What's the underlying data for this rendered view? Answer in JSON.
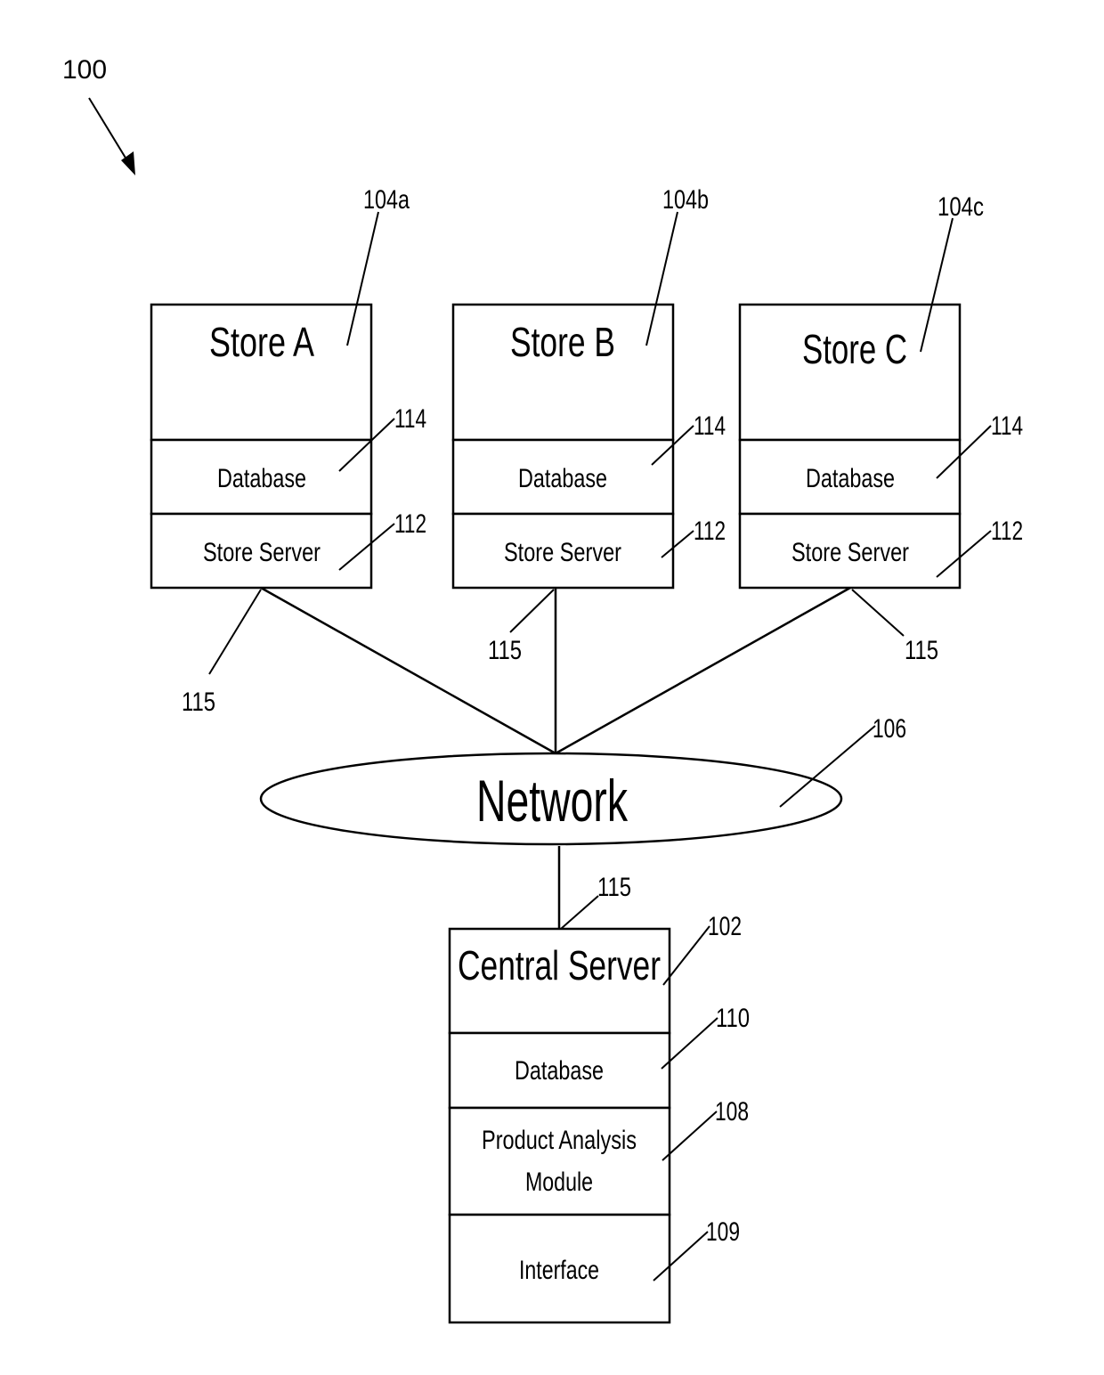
{
  "figure": {
    "ref": "100"
  },
  "stores": [
    {
      "title": "Store A",
      "ref": "104a",
      "database": "Database",
      "database_ref": "114",
      "server": "Store Server",
      "server_ref": "112",
      "link_ref": "115"
    },
    {
      "title": "Store B",
      "ref": "104b",
      "database": "Database",
      "database_ref": "114",
      "server": "Store Server",
      "server_ref": "112",
      "link_ref": "115"
    },
    {
      "title": "Store C",
      "ref": "104c",
      "database": "Database",
      "database_ref": "114",
      "server": "Store Server",
      "server_ref": "112",
      "link_ref": "115"
    }
  ],
  "network": {
    "label": "Network",
    "ref": "106",
    "link_ref": "115"
  },
  "central_server": {
    "title": "Central Server",
    "ref": "102",
    "database": "Database",
    "database_ref": "110",
    "module_line1": "Product Analysis",
    "module_line2": "Module",
    "module_ref": "108",
    "interface": "Interface",
    "interface_ref": "109"
  }
}
